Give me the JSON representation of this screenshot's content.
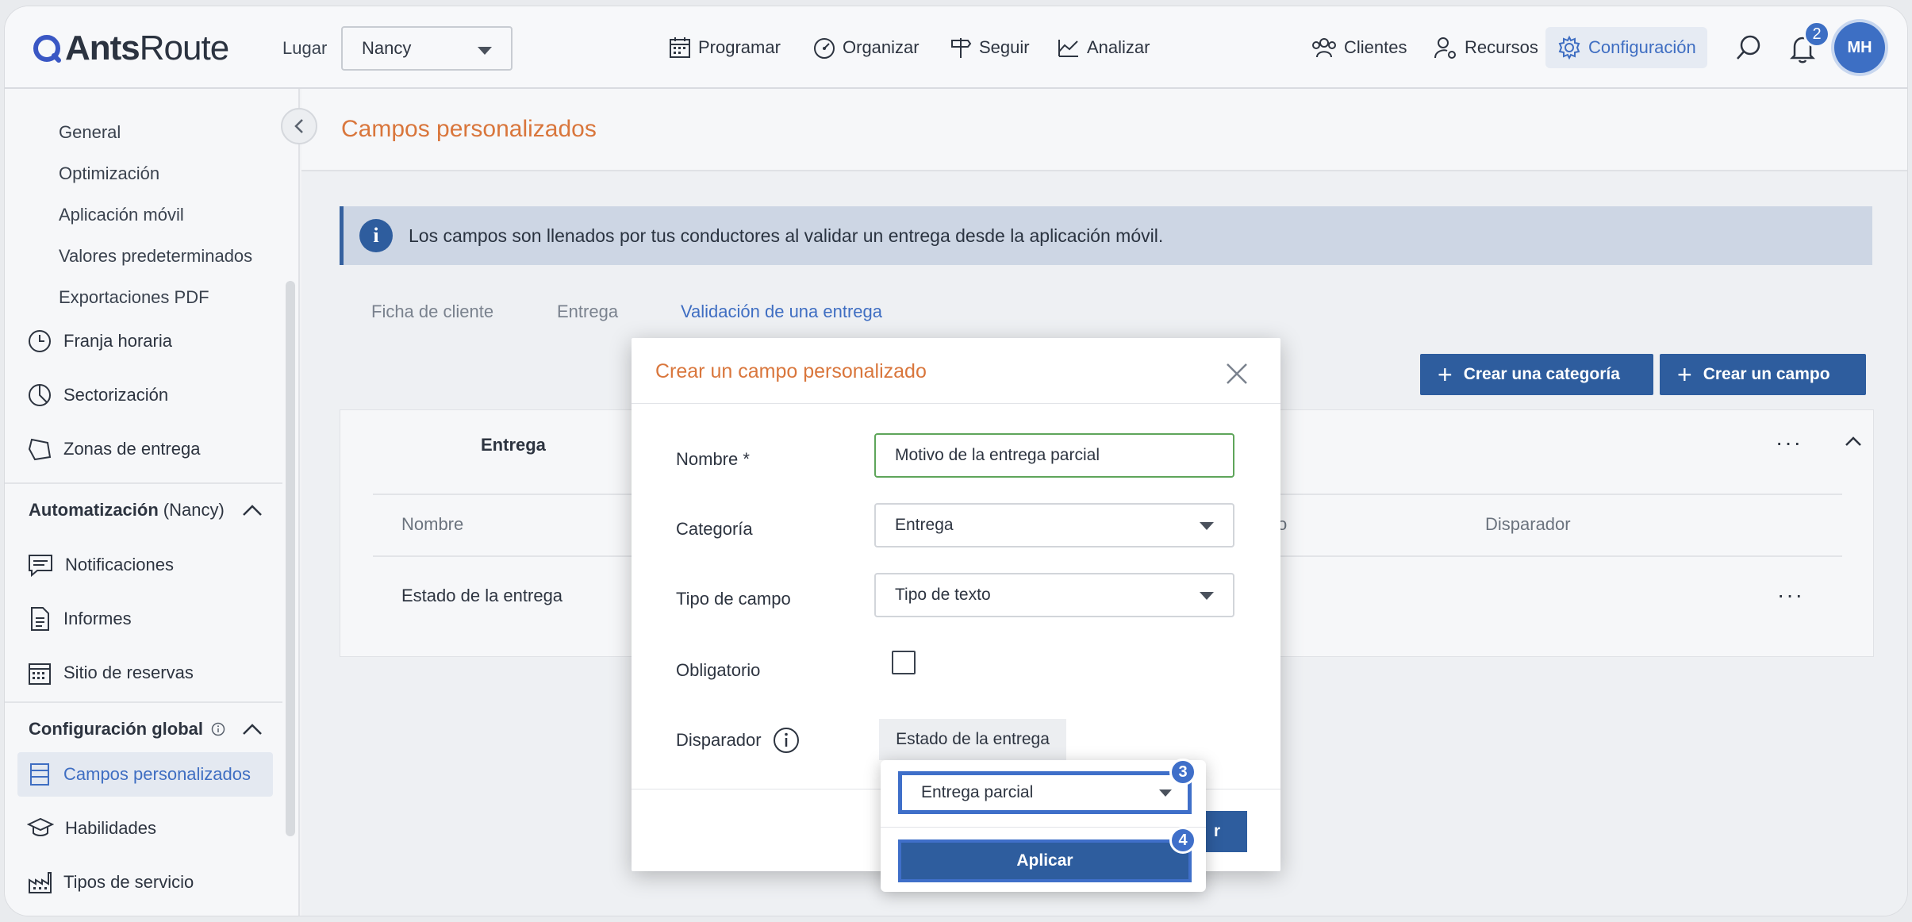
{
  "header": {
    "logo_bold": "Ants",
    "logo_regular": "Route",
    "place_label": "Lugar",
    "place_value": "Nancy",
    "nav": [
      {
        "label": "Programar",
        "icon": "calendar-icon"
      },
      {
        "label": "Organizar",
        "icon": "gauge-icon"
      },
      {
        "label": "Seguir",
        "icon": "signpost-icon"
      },
      {
        "label": "Analizar",
        "icon": "chart-icon"
      }
    ],
    "right_nav": [
      {
        "label": "Clientes",
        "icon": "people-icon"
      },
      {
        "label": "Recursos",
        "icon": "user-gear-icon"
      },
      {
        "label": "Configuración",
        "icon": "gear-icon",
        "active": true
      }
    ],
    "notifications_count": "2",
    "avatar_initials": "MH",
    "accent_color": "#3f6ec2"
  },
  "sidebar": {
    "sub_items": [
      "General",
      "Optimización",
      "Aplicación móvil",
      "Valores predeterminados",
      "Exportaciones PDF"
    ],
    "items_top": [
      {
        "label": "Franja horaria",
        "icon": "clock-icon"
      },
      {
        "label": "Sectorización",
        "icon": "pie-icon"
      },
      {
        "label": "Zonas de entrega",
        "icon": "polygon-icon"
      }
    ],
    "automation_title": "Automatización",
    "automation_suffix": "(Nancy)",
    "automation_items": [
      {
        "label": "Notificaciones",
        "icon": "message-icon"
      },
      {
        "label": "Informes",
        "icon": "document-icon"
      },
      {
        "label": "Sitio de reservas",
        "icon": "calendar-grid-icon"
      }
    ],
    "global_title": "Configuración global",
    "global_items": [
      {
        "label": "Campos personalizados",
        "icon": "table-icon",
        "active": true
      },
      {
        "label": "Habilidades",
        "icon": "graduation-icon"
      },
      {
        "label": "Tipos de servicio",
        "icon": "factory-icon"
      }
    ]
  },
  "main": {
    "page_title": "Campos personalizados",
    "info_text": "Los campos son llenados por tus conductores al validar un entrega desde la aplicación móvil.",
    "tabs": [
      {
        "label": "Ficha de cliente",
        "active": false
      },
      {
        "label": "Entrega",
        "active": false
      },
      {
        "label": "Validación de una entrega",
        "active": true
      }
    ],
    "btn_create_category": "Crear una categoría",
    "btn_create_field": "Crear un campo",
    "card": {
      "title": "Entrega",
      "col_name": "Nombre",
      "col_partial": "o",
      "col_trigger": "Disparador",
      "row_name": "Estado de la entrega"
    }
  },
  "modal": {
    "title": "Crear un campo personalizado",
    "name_label": "Nombre *",
    "name_value": "Motivo de la entrega parcial",
    "category_label": "Categoría",
    "category_value": "Entrega",
    "type_label": "Tipo de campo",
    "type_value": "Tipo de texto",
    "required_label": "Obligatorio",
    "trigger_label": "Disparador",
    "trigger_value": "Estado de la entrega",
    "save_partial": "r"
  },
  "popup": {
    "state_value": "Entrega parcial",
    "apply_label": "Aplicar",
    "step_select": "3",
    "step_apply": "4"
  }
}
